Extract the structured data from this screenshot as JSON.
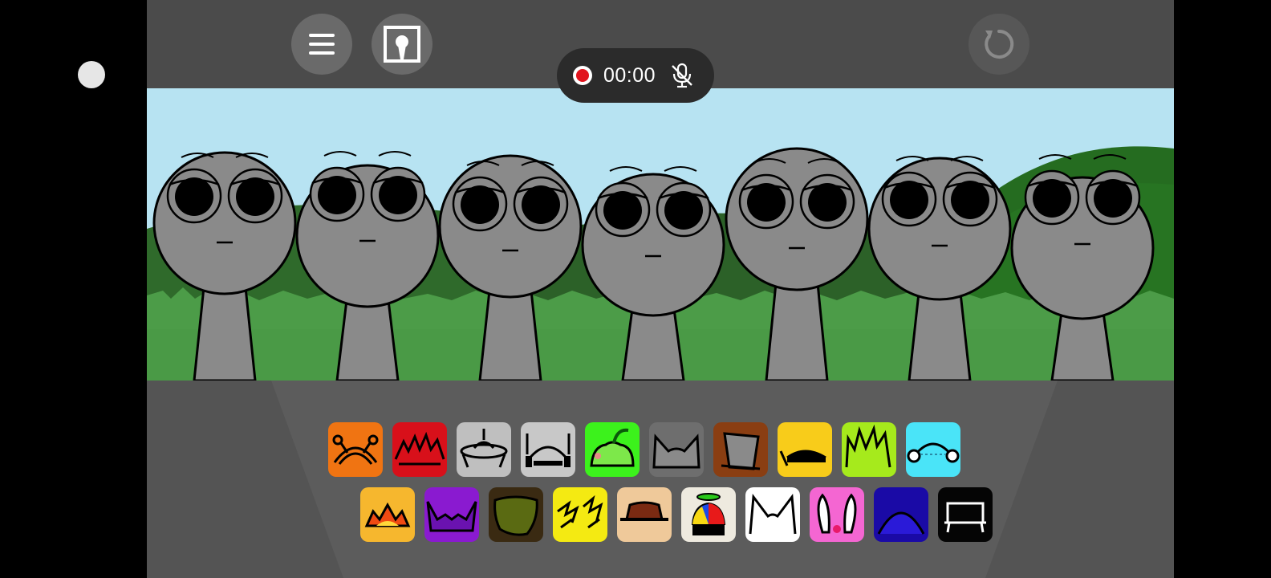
{
  "recorder": {
    "time": "00:00",
    "record_icon": "record-dot-icon",
    "mic_icon": "mic-muted-icon"
  },
  "topbar": {
    "menu_icon": "hamburger-menu-icon",
    "portrait_icon": "portrait-mode-icon",
    "reset_icon": "reset-arrow-icon"
  },
  "colors": {
    "sky": "#b7e3f2",
    "grass": "#4c9c48",
    "character": "#8a8a8a",
    "topbar": "#4b4b4b",
    "stage_floor": "#5c5c5c"
  },
  "characters": 7,
  "sound_icons": {
    "row1": [
      {
        "name": "orange-antenna-sound-icon",
        "bg": "#f07412"
      },
      {
        "name": "red-spiky-sound-icon",
        "bg": "#d8101a"
      },
      {
        "name": "gray-ufo-sound-icon",
        "bg": "#bfbfbf"
      },
      {
        "name": "gray-headphones-sound-icon",
        "bg": "#c8c8c8"
      },
      {
        "name": "green-pepper-sound-icon",
        "bg": "#3cf21c"
      },
      {
        "name": "gray-cat-ears-sound-icon",
        "bg": "#6e6e6e"
      },
      {
        "name": "brown-bucket-sound-icon",
        "bg": "#8a3e12"
      },
      {
        "name": "yellow-visor-sound-icon",
        "bg": "#f8cc1a"
      },
      {
        "name": "lime-spiky-hair-sound-icon",
        "bg": "#a6ea1c"
      },
      {
        "name": "cyan-earmuffs-sound-icon",
        "bg": "#4ae4f8"
      }
    ],
    "row2": [
      {
        "name": "yellow-crown-sound-icon",
        "bg": "#f6b72e"
      },
      {
        "name": "purple-horns-sound-icon",
        "bg": "#8a1ad0"
      },
      {
        "name": "olive-bush-sound-icon",
        "bg": "#3a2a12"
      },
      {
        "name": "yellow-lightning-sound-icon",
        "bg": "#f4ea12"
      },
      {
        "name": "brown-fedora-sound-icon",
        "bg": "#efc99a"
      },
      {
        "name": "propeller-cap-sound-icon",
        "bg": "#eeeadf"
      },
      {
        "name": "white-cat-ears-sound-icon",
        "bg": "#ffffff"
      },
      {
        "name": "pink-bunny-ears-sound-icon",
        "bg": "#f466d2"
      },
      {
        "name": "navy-dome-sound-icon",
        "bg": "#1a0aa6"
      },
      {
        "name": "black-bench-sound-icon",
        "bg": "#050505"
      }
    ]
  }
}
